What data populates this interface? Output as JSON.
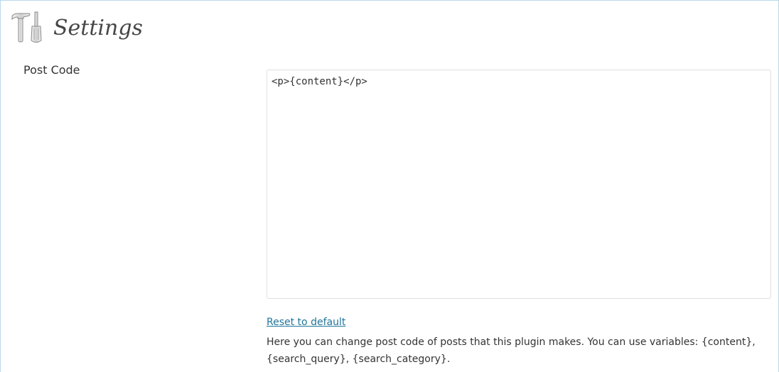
{
  "header": {
    "title": "Settings",
    "icon": "tools-icon"
  },
  "post_code": {
    "label": "Post Code",
    "value": "<p>{content}</p>",
    "reset_label": "Reset to default",
    "description": "Here you can change post code of posts that this plugin makes. You can use variables: {content}, {search_query}, {search_category}."
  },
  "colors": {
    "link": "#21759b",
    "border": "#b9d8ea",
    "text": "#333333"
  }
}
